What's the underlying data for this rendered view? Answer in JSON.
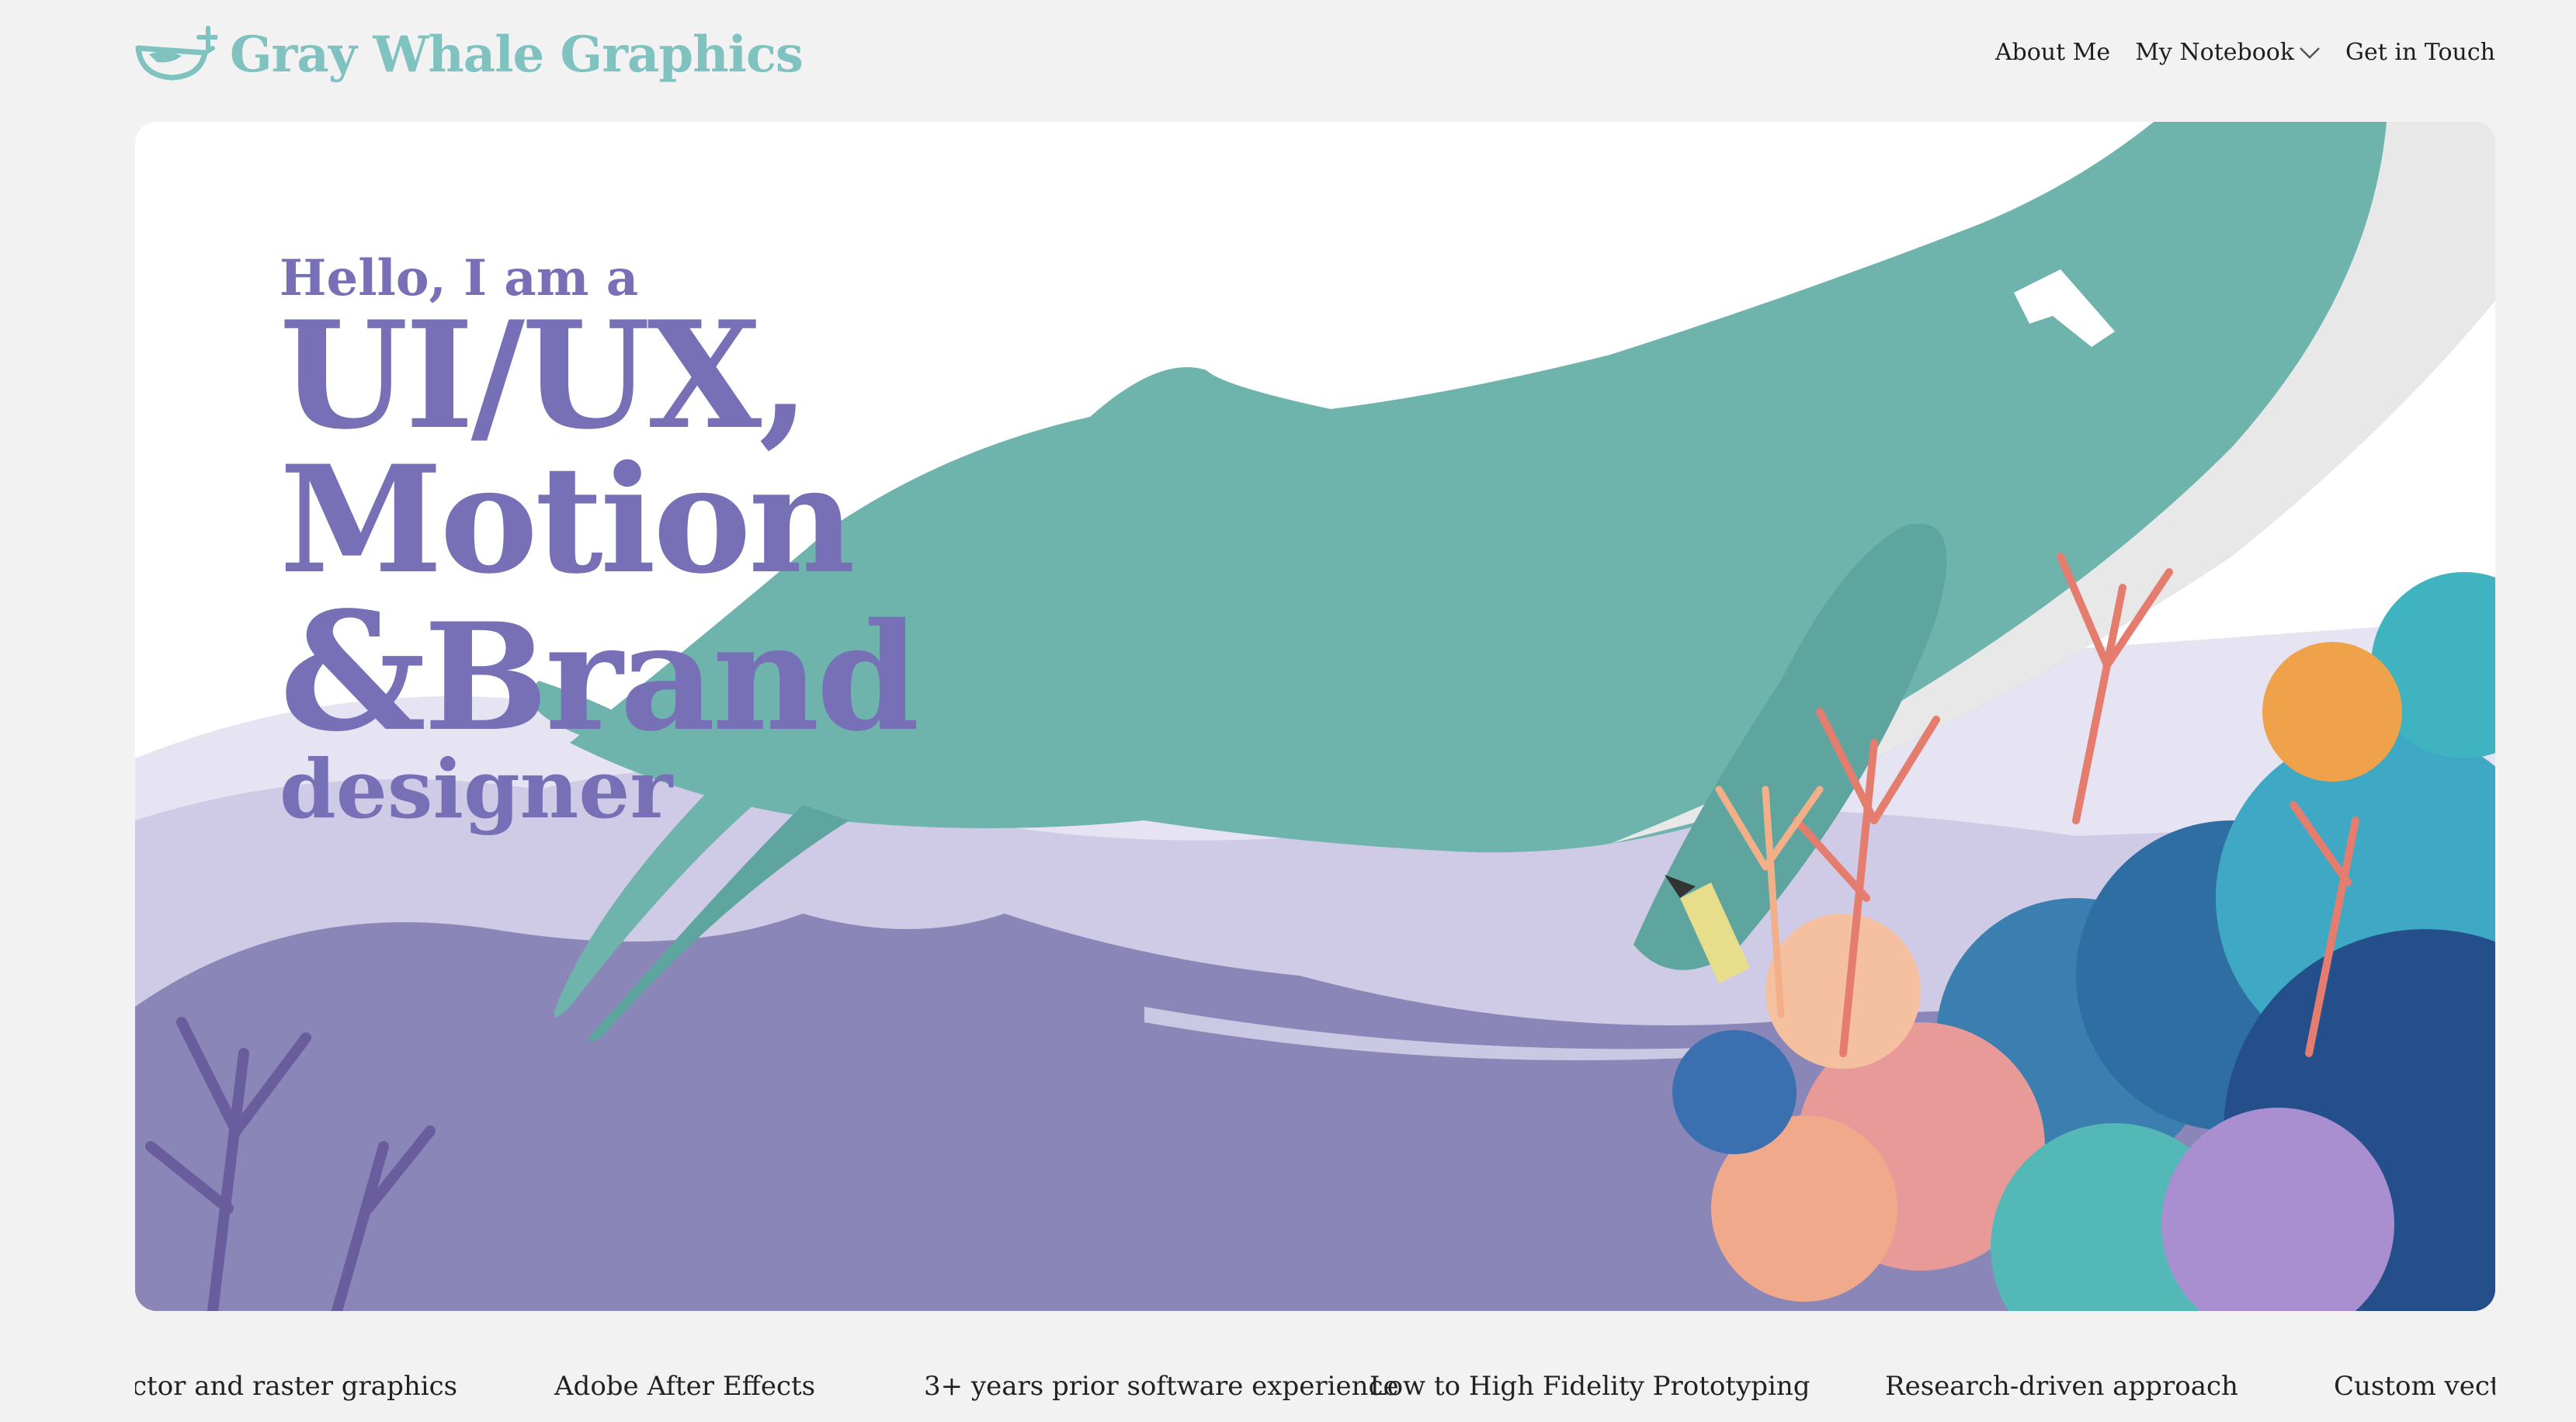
{
  "brand": {
    "name": "Gray Whale Graphics",
    "logo_icon": "whale-in-bowl-icon",
    "color": "#7fc2bf"
  },
  "nav": {
    "items": [
      {
        "label": "About Me"
      },
      {
        "label": "My Notebook",
        "has_dropdown": true,
        "icon": "chevron-down-icon"
      },
      {
        "label": "Get in Touch"
      }
    ]
  },
  "hero": {
    "intro": "Hello, I am a",
    "line1": "UI/UX,",
    "line2": "Motion",
    "amp": "&",
    "line3": "Brand",
    "line4": "designer",
    "text_color": "#7770b6",
    "illustration": "whale-and-coral-reef-illustration",
    "whale_color": "#6fb3ad",
    "seafloor_color": "#8a86b8"
  },
  "skills": [
    "ctor and raster graphics",
    "Adobe After Effects",
    "3+ years prior software experience",
    "Low to High Fidelity Prototyping",
    "Research-driven approach",
    "Custom vecto"
  ]
}
